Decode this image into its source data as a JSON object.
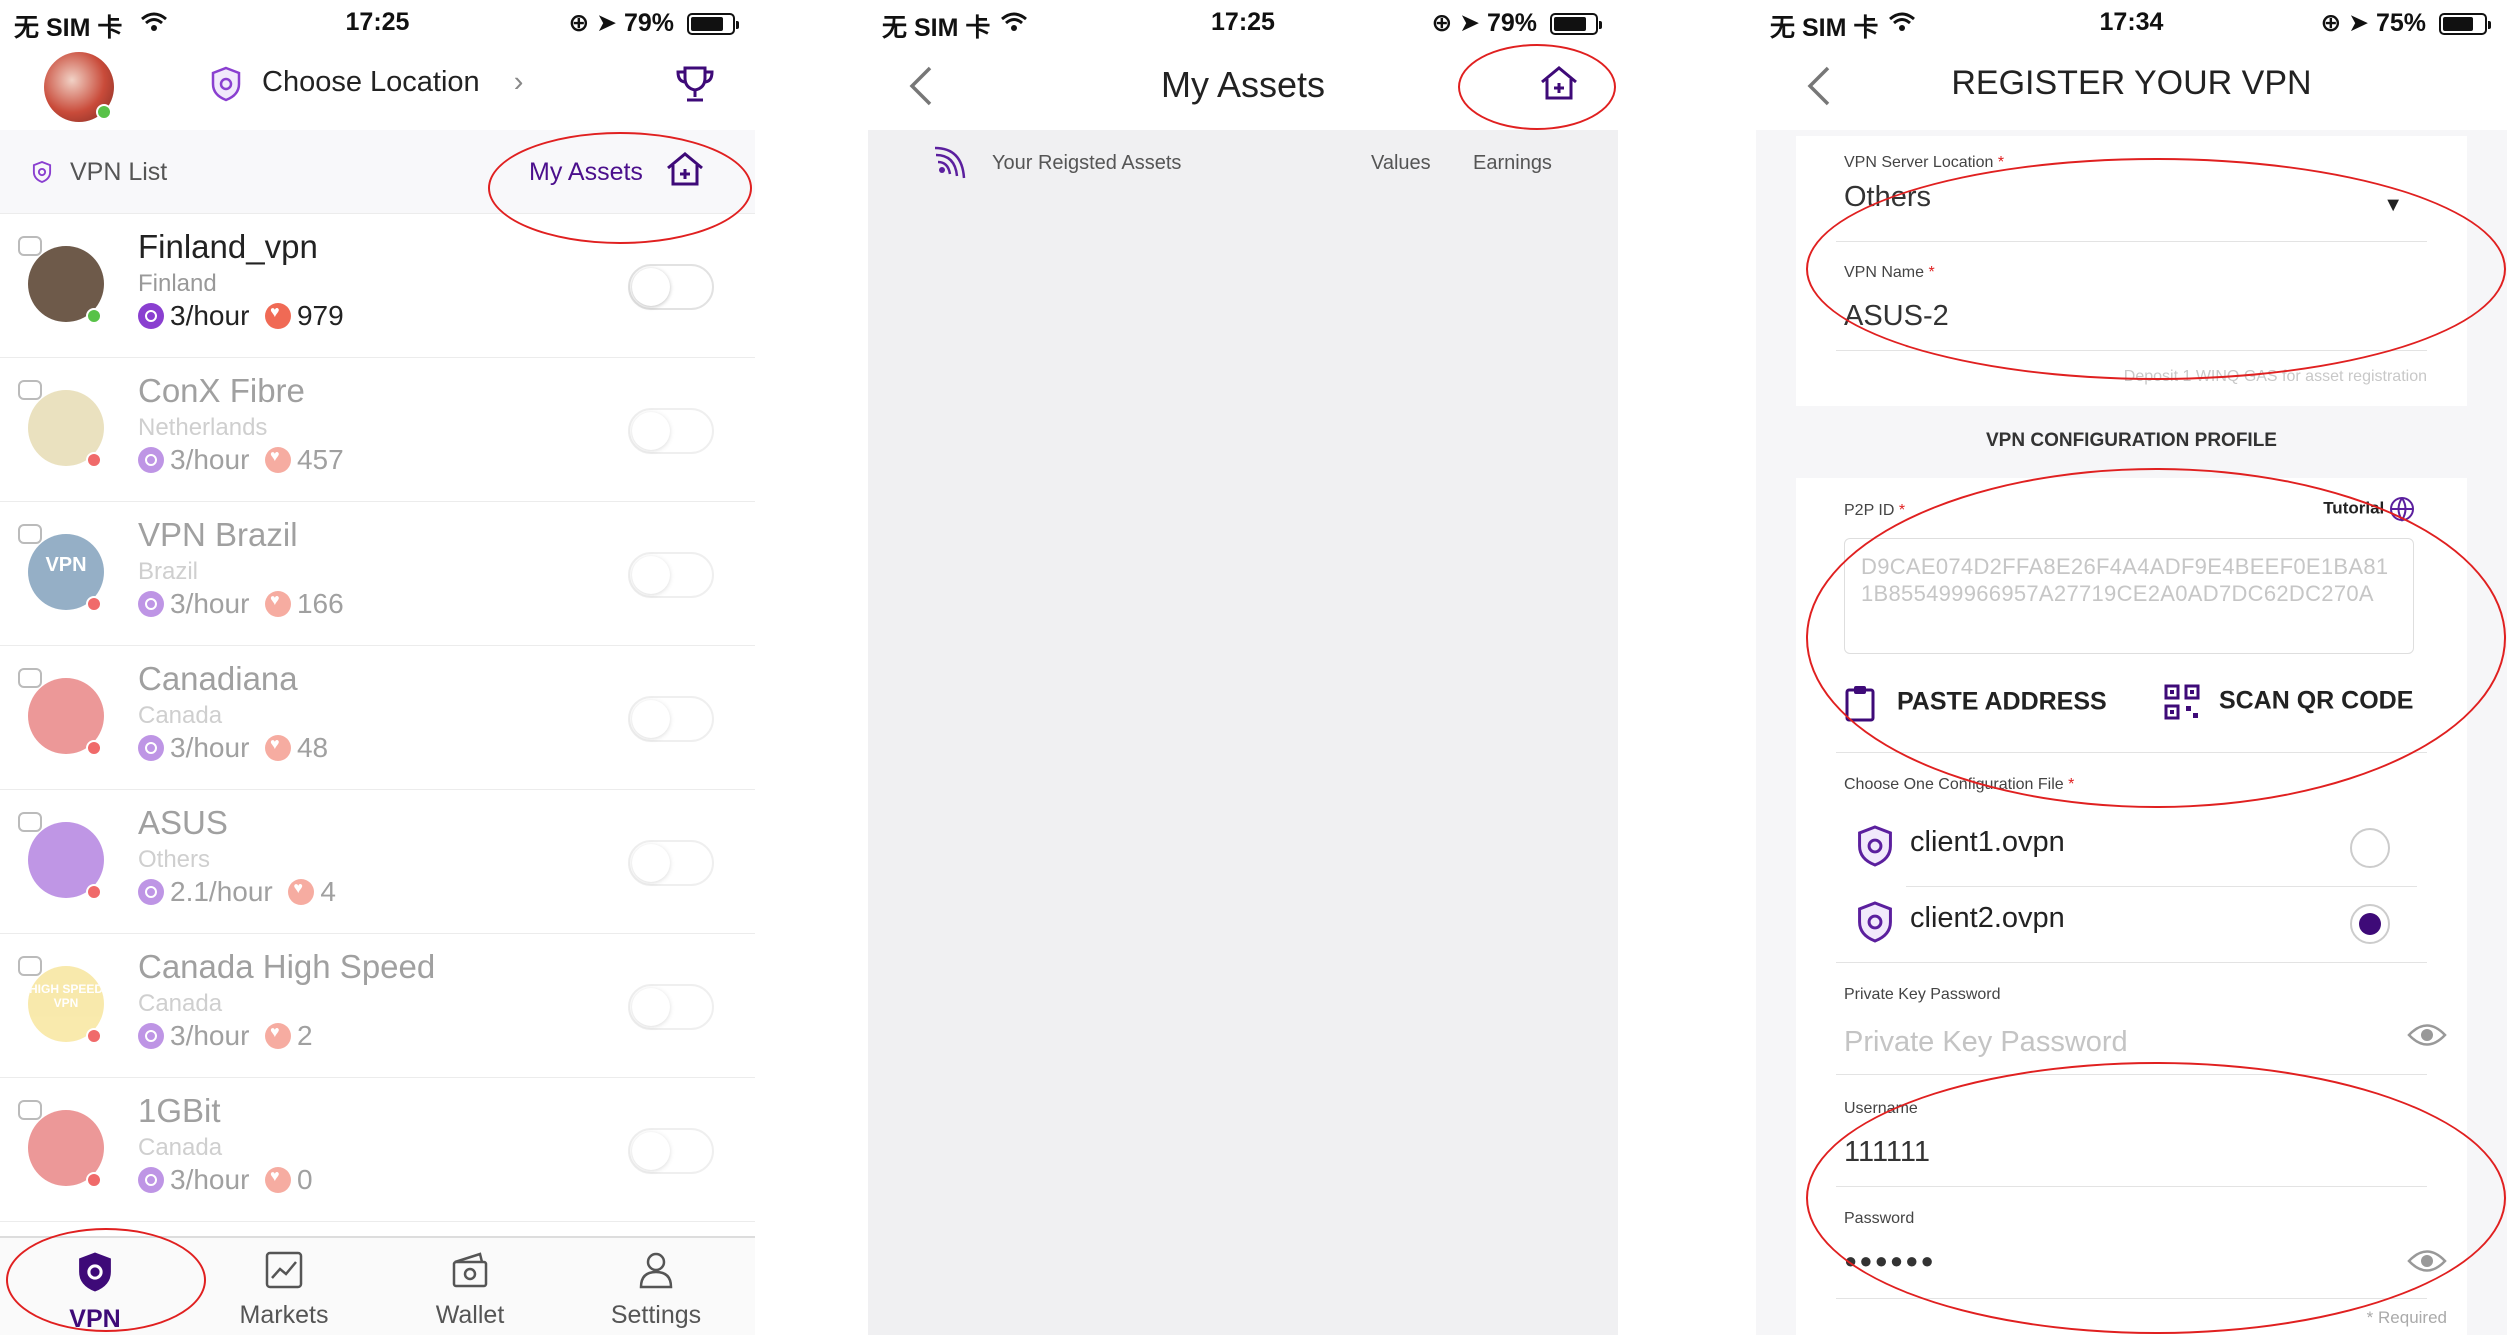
{
  "screen1": {
    "status": {
      "carrier": "无 SIM 卡",
      "time": "17:25",
      "battery": "79%",
      "battery_level": 0.79
    },
    "header": {
      "choose_location": "Choose Location",
      "chevron": "›"
    },
    "subheader": {
      "vpn_list": "VPN List",
      "my_assets": "My Assets"
    },
    "vpns": [
      {
        "name": "Finland_vpn",
        "country": "Finland",
        "rate": "3/hour",
        "count": "979",
        "status_color": "#58c248",
        "avatar_color": "#6e5a4a"
      },
      {
        "name": "ConX Fibre",
        "country": "Netherlands",
        "rate": "3/hour",
        "count": "457",
        "status_color": "#f06a6a",
        "avatar_color": "#d8c98a"
      },
      {
        "name": "VPN Brazil",
        "country": "Brazil",
        "rate": "3/hour",
        "count": "166",
        "status_color": "#f06a6a",
        "avatar_color": "#3f6f99",
        "avatar_text": "VPN"
      },
      {
        "name": "Canadiana",
        "country": "Canada",
        "rate": "3/hour",
        "count": "48",
        "status_color": "#f06a6a",
        "avatar_color": "#d44"
      },
      {
        "name": "ASUS",
        "country": "Others",
        "rate": "2.1/hour",
        "count": "4",
        "status_color": "#f06a6a",
        "avatar_color": "#8a3fd0"
      },
      {
        "name": "Canada High Speed",
        "country": "Canada",
        "rate": "3/hour",
        "count": "2",
        "status_color": "#f06a6a",
        "avatar_color": "#f4d86a",
        "avatar_text": "HIGH SPEED VPN"
      },
      {
        "name": "1GBit",
        "country": "Canada",
        "rate": "3/hour",
        "count": "0",
        "status_color": "#f06a6a",
        "avatar_color": "#d44"
      }
    ],
    "tabs": [
      {
        "label": "VPN",
        "icon": "shield-icon",
        "active": true
      },
      {
        "label": "Markets",
        "icon": "chart-icon",
        "active": false
      },
      {
        "label": "Wallet",
        "icon": "wallet-icon",
        "active": false
      },
      {
        "label": "Settings",
        "icon": "person-icon",
        "active": false
      }
    ]
  },
  "screen2": {
    "status": {
      "carrier": "无 SIM 卡",
      "time": "17:25",
      "battery": "79%",
      "battery_level": 0.79
    },
    "title": "My Assets",
    "columns": {
      "assets": "Your Reigsted Assets",
      "values": "Values",
      "earnings": "Earnings"
    }
  },
  "screen3": {
    "status": {
      "carrier": "无 SIM 卡",
      "time": "17:34",
      "battery": "75%",
      "battery_level": 0.75
    },
    "title": "REGISTER YOUR VPN",
    "server_location": {
      "label": "VPN Server Location",
      "value": "Others"
    },
    "vpn_name": {
      "label": "VPN Name",
      "value": "ASUS-2"
    },
    "deposit_note": "Deposit 1 WINQ GAS for asset registration",
    "section_title": "VPN CONFIGURATION PROFILE",
    "p2p": {
      "label": "P2P ID",
      "tutorial": "Tutorial",
      "value": "D9CAE074D2FFA8E26F4A4ADF9E4BEEF0E1BA811B855499966957A27719CE2A0AD7DC62DC270A"
    },
    "actions": {
      "paste": "PASTE ADDRESS",
      "scan": "SCAN QR CODE"
    },
    "config": {
      "label": "Choose One Configuration File",
      "files": [
        {
          "name": "client1.ovpn",
          "selected": false
        },
        {
          "name": "client2.ovpn",
          "selected": true
        }
      ]
    },
    "private_key": {
      "label": "Private Key Password",
      "placeholder": "Private Key Password"
    },
    "username": {
      "label": "Username",
      "value": "111111"
    },
    "password": {
      "label": "Password",
      "value": "●●●●●●"
    },
    "required_note": "* Required"
  },
  "colors": {
    "brand": "#3e0a78",
    "accent": "#8a3fd0",
    "annotation": "#e02020"
  }
}
